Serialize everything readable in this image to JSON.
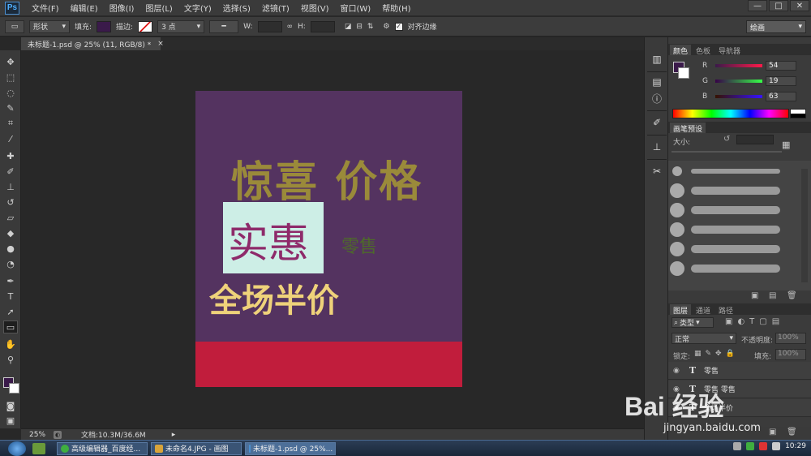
{
  "app": {
    "logo": "Ps"
  },
  "menu": [
    "文件(F)",
    "编辑(E)",
    "图像(I)",
    "图层(L)",
    "文字(Y)",
    "选择(S)",
    "滤镜(T)",
    "视图(V)",
    "窗口(W)",
    "帮助(H)"
  ],
  "window_buttons": [
    "—",
    "□",
    "✕"
  ],
  "options": {
    "mode": "形状",
    "fill_label": "填充:",
    "fill_color": "#3a1a4a",
    "stroke_label": "描边:",
    "stroke_width": "3 点",
    "w_label": "W:",
    "h_label": "H:",
    "align_edges": "对齐边缘",
    "workspace": "绘画"
  },
  "doc_tab": {
    "title": "未标题-1.psd @ 25% (11, RGB/8) *",
    "close": "×"
  },
  "canvas": {
    "headline": "惊喜 价格",
    "box_text": "实惠",
    "small_text": "零售",
    "half_price": "全场半价",
    "colors": {
      "bg": "#543360",
      "box": "#cdeee6",
      "band": "#c11d3c"
    }
  },
  "status": {
    "zoom": "25%",
    "doc_size": "文档:10.3M/36.6M"
  },
  "panels": {
    "color": {
      "tabs": [
        "颜色",
        "色板",
        "导航器"
      ],
      "r_label": "R",
      "g_label": "G",
      "b_label": "B",
      "r": "54",
      "g": "19",
      "b": "63"
    },
    "brush": {
      "tab": "画笔预设",
      "size_label": "大小:"
    },
    "layers": {
      "tabs": [
        "图层",
        "通道",
        "路径"
      ],
      "filter": "类型",
      "blend": "正常",
      "opacity_label": "不透明度:",
      "opacity": "100%",
      "lock_label": "锁定:",
      "fill_label": "填充:",
      "fill": "100%",
      "items": [
        "零售",
        "零售 零售",
        "全场半价"
      ]
    }
  },
  "taskbar": {
    "tasks": [
      "高级编辑器_百度经...",
      "未命名4.JPG - 画图",
      "未标题-1.psd @ 25%..."
    ],
    "time": "10:29"
  },
  "watermark": {
    "logo": "Bai 经验",
    "url": "jingyan.baidu.com"
  }
}
